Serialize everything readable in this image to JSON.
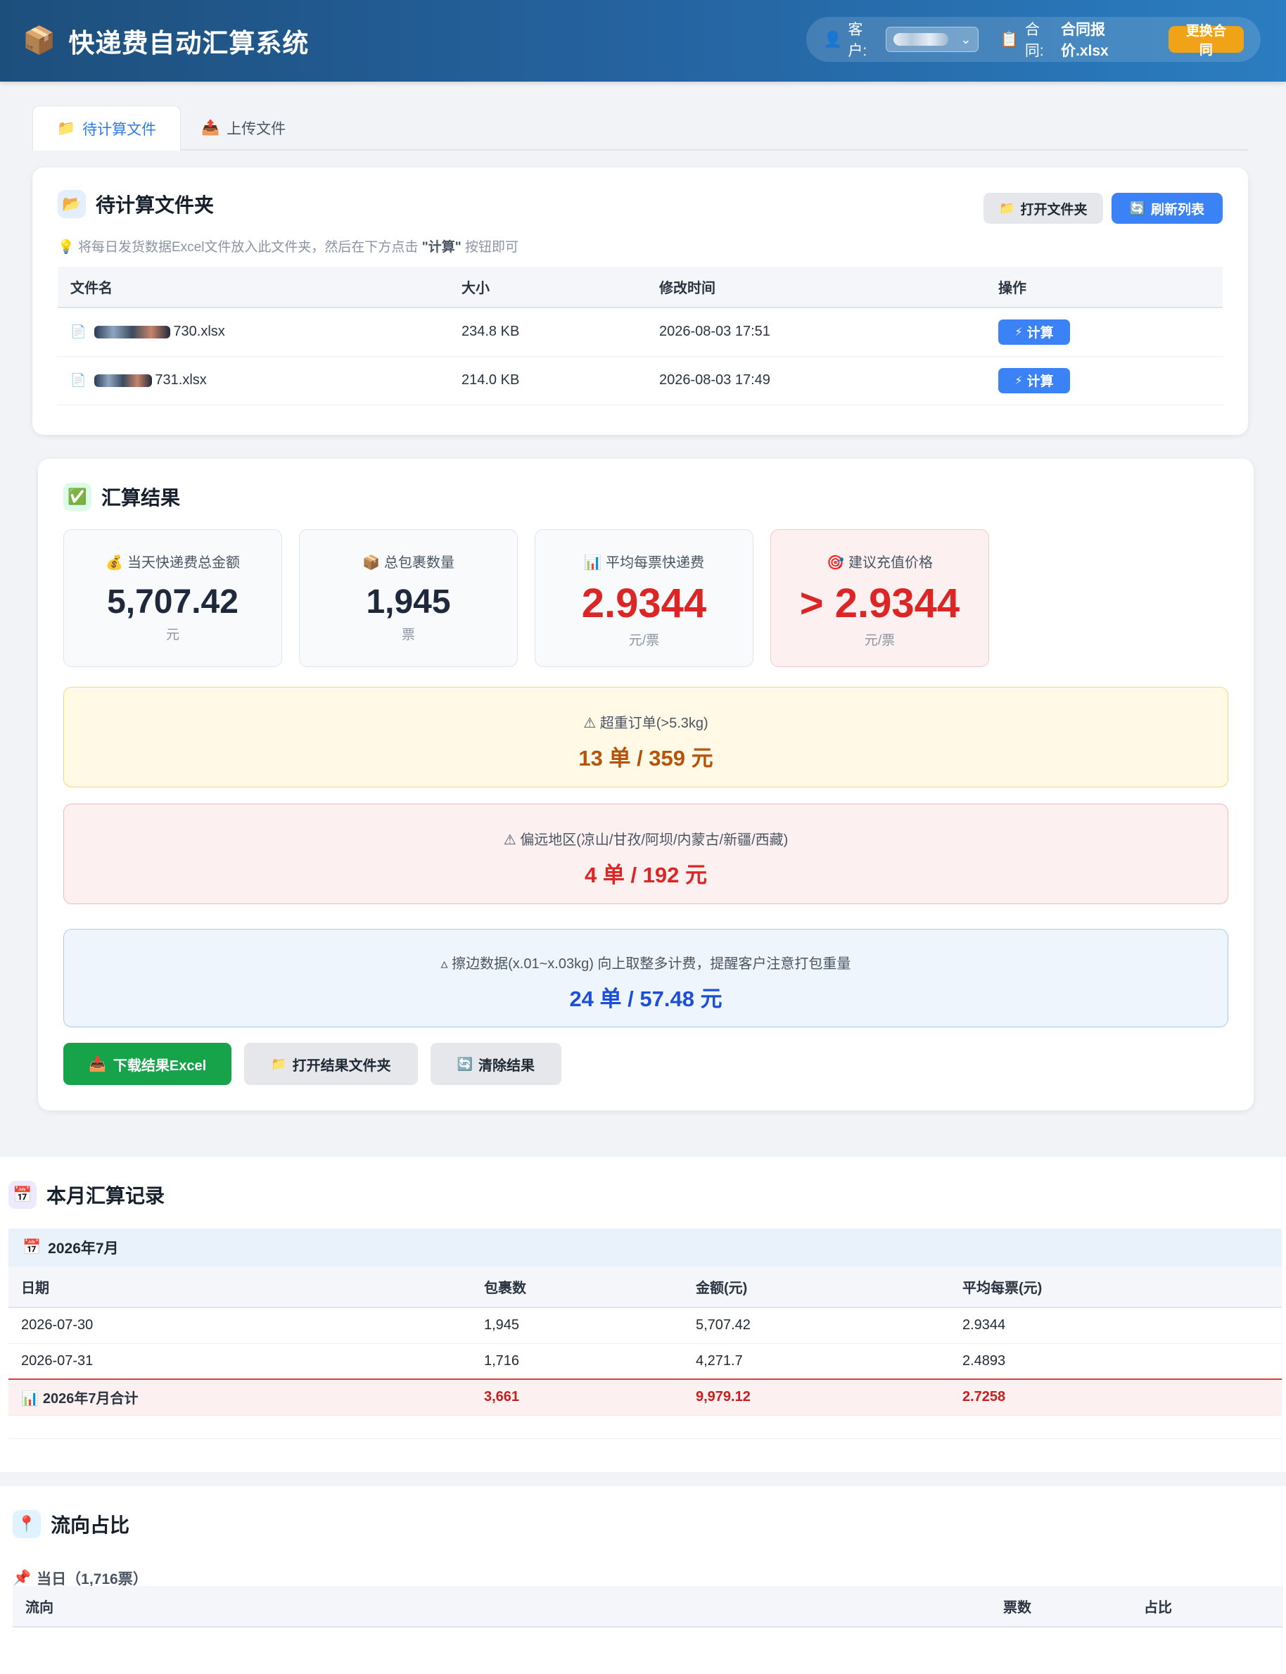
{
  "header": {
    "app_title": "快递费自动汇算系统",
    "app_icon": "package-icon",
    "customer_label": "客户:",
    "contract_label": "合同:",
    "contract_file": "合同报价.xlsx",
    "change_contract": "更换合同"
  },
  "tabs": [
    {
      "label": "待计算文件",
      "icon": "folder-icon",
      "active": true
    },
    {
      "label": "上传文件",
      "icon": "upload-icon",
      "active": false
    }
  ],
  "pending": {
    "title": "待计算文件夹",
    "open_folder": "打开文件夹",
    "refresh": "刷新列表",
    "hint_prefix": "将每日发货数据Excel文件放入此文件夹，然后在下方点击 ",
    "hint_bold": "\"计算\"",
    "hint_suffix": " 按钮即可",
    "columns": [
      "文件名",
      "大小",
      "修改时间",
      "操作"
    ],
    "files": [
      {
        "name_suffix": "730.xlsx",
        "size": "234.8 KB",
        "mtime": "2026-08-03 17:51",
        "action": "计算"
      },
      {
        "name_suffix": "731.xlsx",
        "size": "214.0 KB",
        "mtime": "2026-08-03 17:49",
        "action": "计算"
      }
    ]
  },
  "result": {
    "title": "汇算结果",
    "stats": [
      {
        "label": "当天快递费总金额",
        "value": "5,707.42",
        "unit": "元"
      },
      {
        "label": "总包裹数量",
        "value": "1,945",
        "unit": "票"
      },
      {
        "label": "平均每票快递费",
        "value": "2.9344",
        "unit": "元/票"
      },
      {
        "label": "建议充值价格",
        "value": "> 2.9344",
        "unit": "元/票"
      }
    ],
    "overweight": {
      "label": "⚠ 超重订单(>5.3kg)",
      "value": "13 单 / 359 元"
    },
    "remote": {
      "label": "⚠ 偏远地区(凉山/甘孜/阿坝/内蒙古/新疆/西藏)",
      "value": "4 单 / 192 元"
    },
    "edge": {
      "label": "▵ 擦边数据(x.01~x.03kg) 向上取整多计费，提醒客户注意打包重量",
      "value": "24 单 / 57.48 元"
    },
    "download": "下载结果Excel",
    "open_result_folder": "打开结果文件夹",
    "clear": "清除结果"
  },
  "monthly": {
    "title": "本月汇算记录",
    "month": "2026年7月",
    "columns": [
      "日期",
      "包裹数",
      "金额(元)",
      "平均每票(元)"
    ],
    "rows": [
      {
        "date": "2026-07-30",
        "count": "1,945",
        "amount": "5,707.42",
        "avg": "2.9344"
      },
      {
        "date": "2026-07-31",
        "count": "1,716",
        "amount": "4,271.7",
        "avg": "2.4893"
      }
    ],
    "total": {
      "label": "2026年7月合计",
      "count": "3,661",
      "amount": "9,979.12",
      "avg": "2.7258"
    }
  },
  "flow": {
    "title": "流向占比",
    "subtitle": "当日（1,716票）",
    "columns": [
      "流向",
      "票数",
      "占比"
    ]
  }
}
